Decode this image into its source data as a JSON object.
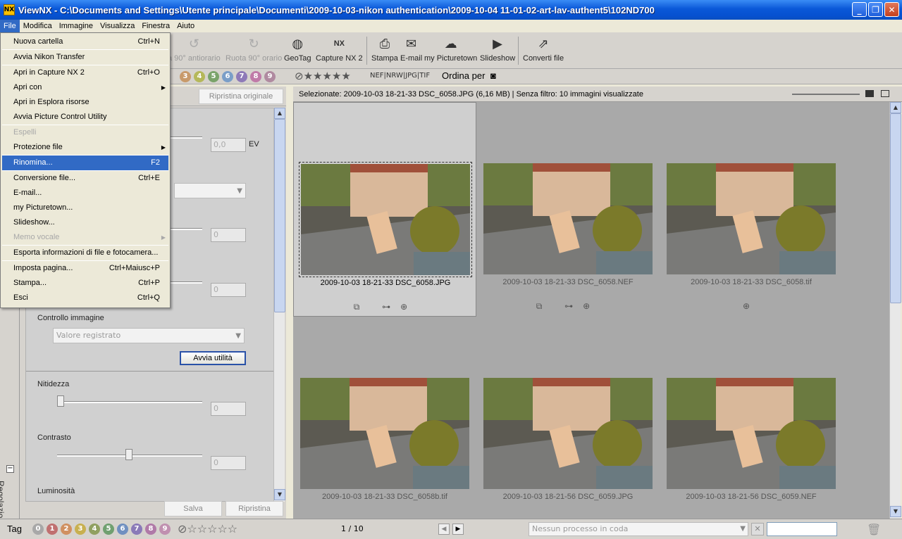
{
  "window": {
    "title": "ViewNX - C:\\Documents and Settings\\Utente principale\\Documenti\\2009-10-03-nikon authentication\\2009-10-04 11-01-02-art-lav-authent5\\102ND700",
    "app_icon": "NX"
  },
  "menubar": [
    "File",
    "Modifica",
    "Immagine",
    "Visualizza",
    "Finestra",
    "Aiuto"
  ],
  "file_menu": [
    {
      "label": "Nuova cartella",
      "shortcut": "Ctrl+N"
    },
    {
      "label": "Avvia Nikon Transfer",
      "shortcut": ""
    },
    {
      "label": "Apri in Capture NX 2",
      "shortcut": "Ctrl+O"
    },
    {
      "label": "Apri con",
      "shortcut": "",
      "submenu": true
    },
    {
      "label": "Apri in Esplora risorse",
      "shortcut": ""
    },
    {
      "label": "Avvia Picture Control Utility",
      "shortcut": ""
    },
    {
      "label": "Espelli",
      "shortcut": "",
      "disabled": true
    },
    {
      "label": "Protezione file",
      "shortcut": "",
      "submenu": true
    },
    {
      "label": "Rinomina...",
      "shortcut": "F2",
      "highlighted": true
    },
    {
      "label": "Conversione file...",
      "shortcut": "Ctrl+E"
    },
    {
      "label": "E-mail...",
      "shortcut": ""
    },
    {
      "label": "my Picturetown...",
      "shortcut": ""
    },
    {
      "label": "Slideshow...",
      "shortcut": ""
    },
    {
      "label": "Memo vocale",
      "shortcut": "",
      "disabled": true,
      "submenu": true
    },
    {
      "label": "Esporta informazioni di file e fotocamera...",
      "shortcut": ""
    },
    {
      "label": "Imposta pagina...",
      "shortcut": "Ctrl+Maiusc+P"
    },
    {
      "label": "Stampa...",
      "shortcut": "Ctrl+P"
    },
    {
      "label": "Esci",
      "shortcut": "Ctrl+Q"
    }
  ],
  "toolbar": {
    "rotate_ccw": "a 90° antiorario",
    "rotate_cw": "Ruota 90° orario",
    "geotag": "GeoTag",
    "capture_nx": "Capture NX 2",
    "print": "Stampa",
    "email": "E-mail",
    "picturetown": "my Picturetown",
    "slideshow": "Slideshow",
    "convert": "Converti file"
  },
  "toolbar2": {
    "labels": [
      "3",
      "4",
      "5",
      "6",
      "7",
      "8",
      "9"
    ],
    "label_colors": [
      "#c89a6a",
      "#b5b85a",
      "#7aa36a",
      "#7a9ec8",
      "#8e7ab8",
      "#c07aa8",
      "#b08aa0"
    ],
    "rating": "⊘★★★★★",
    "filetypes": "NEF|NRW|JPG|TIF",
    "sort_label": "Ordina per"
  },
  "left_panel": {
    "reset_original": "Ripristina originale",
    "ev_value": "0,0",
    "ev_unit": "EV",
    "field_2_value": "0",
    "field_3_value": "0",
    "picture_control_label": "Controllo immagine",
    "picture_control_value": "Valore registrato",
    "launch_utility": "Avvia utilità",
    "sharpness_label": "Nitidezza",
    "sharpness_value": "0",
    "contrast_label": "Contrasto",
    "contrast_value": "0",
    "brightness_label": "Luminosità",
    "save": "Salva",
    "restore": "Ripristina",
    "vertical_tab": "Regolazione rapida"
  },
  "status": {
    "selection": "Selezionate: 2009-10-03 18-21-33 DSC_6058.JPG (6,16 MB) | Senza filtro: 10 immagini visualizzate"
  },
  "thumbnails": [
    {
      "caption": "2009-10-03 18-21-33 DSC_6058.JPG",
      "selected": true,
      "icons": "⧉ ⊶⊕"
    },
    {
      "caption": "2009-10-03 18-21-33 DSC_6058.NEF",
      "selected": false,
      "icons": "⧉ ⊶⊕"
    },
    {
      "caption": "2009-10-03 18-21-33 DSC_6058.tif",
      "selected": false,
      "icons": "⊕"
    },
    {
      "caption": "2009-10-03 18-21-33 DSC_6058b.tif",
      "selected": false,
      "icons": ""
    },
    {
      "caption": "2009-10-03 18-21-56 DSC_6059.JPG",
      "selected": false,
      "icons": ""
    },
    {
      "caption": "2009-10-03 18-21-56 DSC_6059.NEF",
      "selected": false,
      "icons": ""
    }
  ],
  "bottombar": {
    "tag_label": "Tag",
    "tags": [
      "0",
      "1",
      "2",
      "3",
      "4",
      "5",
      "6",
      "7",
      "8",
      "9"
    ],
    "tag_colors": [
      "#a8a8a8",
      "#c07070",
      "#d09060",
      "#c8b050",
      "#90a060",
      "#70a070",
      "#7090c0",
      "#8a7ab8",
      "#b07aa8",
      "#c090b0"
    ],
    "rating": "⊘☆☆☆☆☆",
    "page": "1 / 10",
    "queue": "Nessun processo in coda"
  }
}
